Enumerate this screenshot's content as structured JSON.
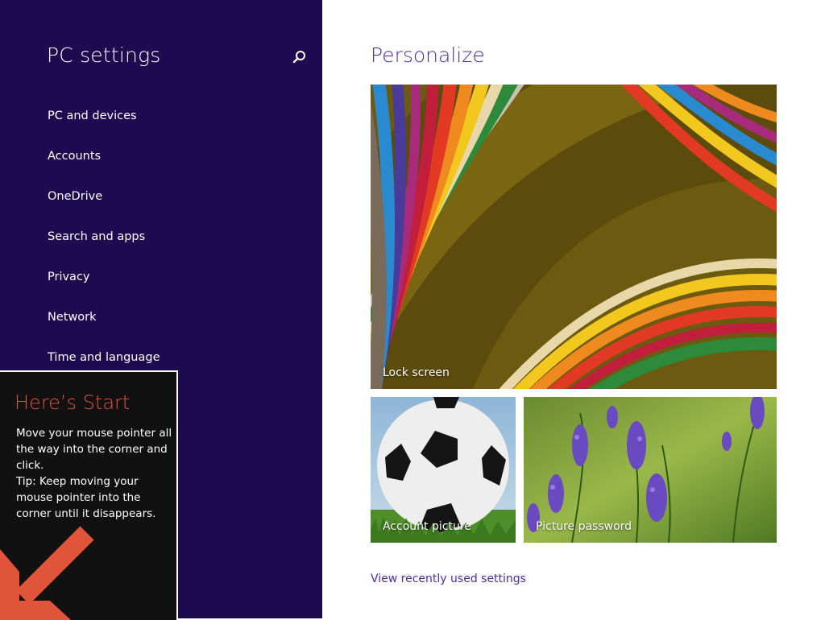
{
  "sidebar": {
    "title": "PC settings",
    "search_icon": "search-icon",
    "items": [
      {
        "label": "PC and devices"
      },
      {
        "label": "Accounts"
      },
      {
        "label": "OneDrive"
      },
      {
        "label": "Search and apps"
      },
      {
        "label": "Privacy"
      },
      {
        "label": "Network"
      },
      {
        "label": "Time and language"
      }
    ],
    "background_color": "#1e0a50"
  },
  "main": {
    "title": "Personalize",
    "tiles": {
      "lock_screen": "Lock screen",
      "account_picture": "Account picture",
      "picture_password": "Picture password"
    },
    "recent_link": "View recently used settings",
    "accent_color": "#4a2e9e"
  },
  "start_tip": {
    "heading": "Here’s Start",
    "body": "Move your mouse pointer all the way into the corner and click.",
    "tip": "Tip: Keep moving your mouse pointer into the corner until it disappears.",
    "arrow_icon": "arrow-down-left-icon",
    "heading_color": "#e0553a"
  }
}
